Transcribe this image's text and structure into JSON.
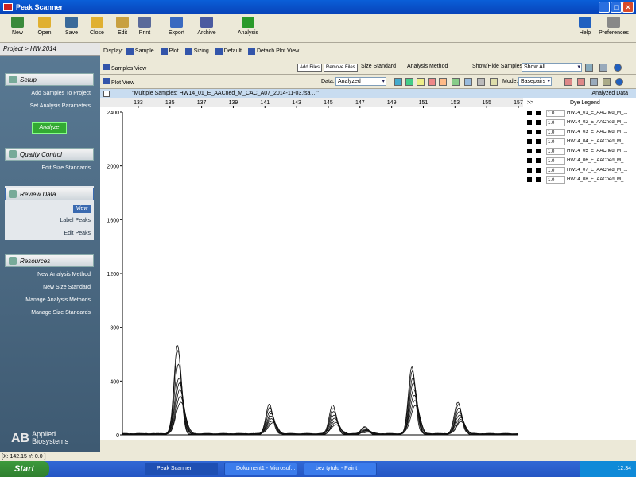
{
  "window": {
    "title": "Peak Scanner"
  },
  "toolbar": {
    "items": [
      {
        "label": "New",
        "color": "#3a8a3a"
      },
      {
        "label": "Open",
        "color": "#e0b030"
      },
      {
        "label": "Save",
        "color": "#3a6a9a"
      },
      {
        "label": "Close",
        "color": "#e0b030"
      },
      {
        "label": "Edit",
        "color": "#c8a040"
      },
      {
        "label": "Print",
        "color": "#5a6a9a"
      },
      {
        "label": "Export",
        "color": "#3a6ac0"
      },
      {
        "label": "Archive",
        "color": "#4a5aa0"
      },
      {
        "label": "Analysis",
        "color": "#2a9a2a"
      },
      {
        "label": "Help",
        "color": "#2060c0"
      },
      {
        "label": "Preferences",
        "color": "#888888"
      }
    ]
  },
  "sidebar": {
    "project": "Project > HW.2014",
    "setup": {
      "title": "Setup",
      "links": [
        "Add Samples To Project",
        "Set Analysis Parameters"
      ],
      "analyze": "Analyze"
    },
    "quality": {
      "title": "Quality Control",
      "links": [
        "Edit Size Standards"
      ]
    },
    "review": {
      "title": "Review Data",
      "view": "View",
      "links": [
        "Label Peaks",
        "Edit Peaks"
      ]
    },
    "resources": {
      "title": "Resources",
      "links": [
        "New Analysis Method",
        "New Size Standard",
        "Manage Analysis Methods",
        "Manage Size Standards"
      ]
    },
    "logo": {
      "mark": "AB",
      "line1": "Applied",
      "line2": "Biosystems"
    }
  },
  "display": {
    "label": "Display:",
    "options": [
      "Sample",
      "Plot",
      "Sizing",
      "Default",
      "Detach Plot View"
    ]
  },
  "samples": {
    "tab": "Samples View",
    "add": "Add Files",
    "remove": "Remove Files",
    "size_standard": "Size Standard",
    "analysis_method": "Analysis Method",
    "showhide": "Show/Hide Samples:",
    "showall": "Show All"
  },
  "plotbar": {
    "tab": "Plot View",
    "data_label": "Data:",
    "data_value": "Analyzed",
    "mode_label": "Mode:",
    "mode_value": "Basepairs"
  },
  "plot_title": "\"Multiple Samples: HW14_01_E_AACned_M_CAC_A07_2014-11-03.fsa ...\"",
  "analyzed_data": "Analyzed Data",
  "legend": {
    "expand": ">>",
    "title": "Dye Legend",
    "rows": [
      {
        "val": "1.0",
        "name": "HW14_01_E_AACned_M_..."
      },
      {
        "val": "1.0",
        "name": "HW14_02_E_AACned_M_..."
      },
      {
        "val": "1.0",
        "name": "HW14_03_E_AACned_M_..."
      },
      {
        "val": "1.0",
        "name": "HW14_04_E_AACned_M_..."
      },
      {
        "val": "1.0",
        "name": "HW14_05_E_AACned_M_..."
      },
      {
        "val": "1.0",
        "name": "HW14_06_E_AACned_M_..."
      },
      {
        "val": "1.0",
        "name": "HW14_07_E_AACned_M_..."
      },
      {
        "val": "1.0",
        "name": "HW14_08_E_AACned_M_..."
      }
    ]
  },
  "chart_data": {
    "type": "line",
    "xlabel": "",
    "ylabel": "",
    "xlim": [
      132,
      157
    ],
    "ylim": [
      0,
      2400
    ],
    "xticks": [
      133,
      135,
      137,
      139,
      141,
      143,
      145,
      147,
      149,
      151,
      153,
      155,
      157
    ],
    "yticks": [
      0,
      400,
      800,
      1200,
      1600,
      2000,
      2400
    ],
    "peaks": [
      {
        "x": 135.6,
        "heights": [
          660,
          620,
          520,
          420,
          380,
          330,
          280,
          240
        ]
      },
      {
        "x": 141.4,
        "heights": [
          220,
          200,
          175,
          150,
          130,
          115,
          100,
          85
        ]
      },
      {
        "x": 145.4,
        "heights": [
          220,
          190,
          165,
          140,
          120,
          100,
          85,
          70
        ]
      },
      {
        "x": 147.4,
        "heights": [
          55,
          50,
          40,
          35,
          30,
          25,
          20,
          15
        ]
      },
      {
        "x": 150.4,
        "heights": [
          500,
          470,
          420,
          380,
          330,
          290,
          250,
          210
        ]
      },
      {
        "x": 153.3,
        "heights": [
          240,
          220,
          190,
          165,
          145,
          125,
          105,
          90
        ]
      }
    ]
  },
  "status": "[X: 142.15  Y: 0.0 ]",
  "taskbar": {
    "start": "Start",
    "tasks": [
      "Peak Scanner",
      "Dokument1 - Microsof...",
      "bez tytułu - Paint"
    ],
    "clock": "12:34"
  }
}
